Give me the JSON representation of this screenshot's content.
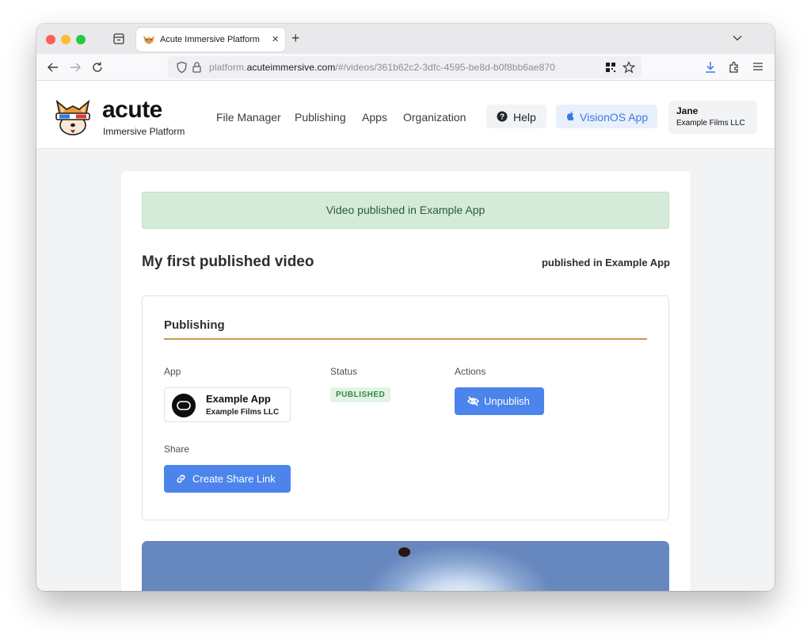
{
  "browser": {
    "tab_title": "Acute Immersive Platform",
    "tab_close": "×",
    "new_tab": "+",
    "url_prefix": "platform.",
    "url_domain": "acuteimmersive.com",
    "url_path": "/#/videos/361b62c2-3dfc-4595-be8d-b0f8bb6ae870"
  },
  "header": {
    "brand_name": "acute",
    "brand_sub": "Immersive Platform",
    "nav": [
      "File Manager",
      "Publishing",
      "Apps",
      "Organization"
    ],
    "help_label": "Help",
    "visionos_label": "VisionOS App",
    "user_name": "Jane",
    "user_org": "Example Films LLC"
  },
  "main": {
    "alert": "Video published in Example App",
    "video_title": "My first published video",
    "published_in": "published in Example App",
    "publishing": {
      "heading": "Publishing",
      "col_app": "App",
      "col_status": "Status",
      "col_actions": "Actions",
      "app_name": "Example App",
      "app_org": "Example Films LLC",
      "status": "PUBLISHED",
      "unpublish_label": "Unpublish",
      "share_label_heading": "Share",
      "share_button_label": "Create Share Link"
    }
  },
  "colors": {
    "accent": "#4c84ec",
    "rule": "#c89a4a",
    "alert_bg": "#d5ebd9",
    "status_green": "#2f8a45"
  }
}
